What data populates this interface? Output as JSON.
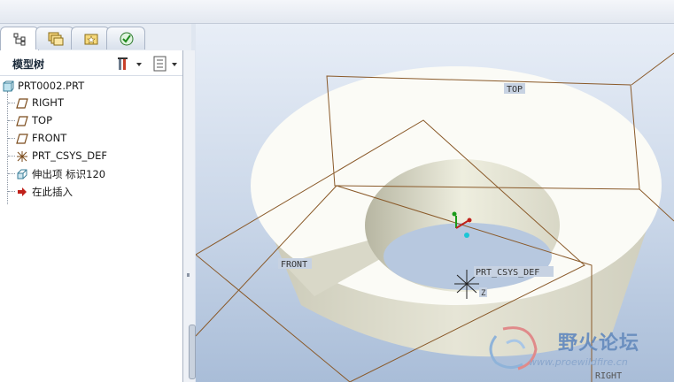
{
  "tabs": [
    {
      "icon": "model-tree-icon"
    },
    {
      "icon": "folder-browser-icon"
    },
    {
      "icon": "favorites-icon"
    },
    {
      "icon": "connections-icon"
    }
  ],
  "panel": {
    "title": "模型树",
    "settings_icon": "tools-icon",
    "show_icon": "tree-options-icon"
  },
  "tree": {
    "root": "PRT0002.PRT",
    "items": [
      {
        "label": "RIGHT",
        "icon": "datum-plane-icon"
      },
      {
        "label": "TOP",
        "icon": "datum-plane-icon"
      },
      {
        "label": "FRONT",
        "icon": "datum-plane-icon"
      },
      {
        "label": "PRT_CSYS_DEF",
        "icon": "coordinate-system-icon"
      },
      {
        "label": "伸出项 标识120",
        "icon": "extrude-feature-icon"
      },
      {
        "label": "在此插入",
        "icon": "insert-here-arrow-icon"
      }
    ]
  },
  "viewport": {
    "labels": {
      "top": "TOP",
      "front": "FRONT",
      "right": "RIGHT",
      "csys": "PRT_CSYS_DEF",
      "csys_tag": "Z"
    }
  },
  "watermark": {
    "text": "野火论坛",
    "url": "www.proewildfire.cn"
  },
  "colors": {
    "datum": "#8a5a2a",
    "part_face": "#fbfbf6",
    "part_side": "#dcdccc",
    "viewport_top": "#e8eef7",
    "viewport_bottom": "#a9bdd8"
  }
}
